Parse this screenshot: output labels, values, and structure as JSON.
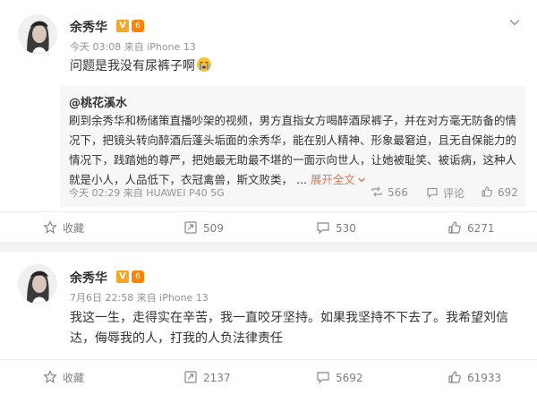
{
  "post1": {
    "author": "余秀华",
    "level_badge": "6",
    "verified_badge": "V",
    "meta": "今天 03:08 来自 iPhone 13",
    "text": "问题是我没有尿裤子啊",
    "retweet": {
      "author": "@桃花溪水",
      "text": "刷到余秀华和杨储策直播吵架的视频，男方直指女方喝醉酒尿裤子，并在对方毫无防备的情况下，把镜头转向醉酒后蓬头垢面的余秀华，能在别人精神、形象最窘迫，且无自保能力的情况下，践踏她的尊严，把她最无助最不堪的一面示向世人，让她被耻笑、被诟病，这种人就是小人，人品低下，衣冠禽兽，斯文败类，",
      "ellipsis": "...",
      "more": "展开全文",
      "meta": "今天 02:29 来自 HUAWEI P40 5G",
      "reposts": "566",
      "comments": "评论",
      "likes": "692"
    },
    "actions": {
      "favorite": "收藏",
      "reposts": "509",
      "comments": "530",
      "likes": "6271"
    }
  },
  "post2": {
    "author": "余秀华",
    "level_badge": "6",
    "verified_badge": "V",
    "meta": "7月6日 22:58 来自 iPhone 13",
    "text": "我这一生，走得实在辛苦，我一直咬牙坚持。如果我坚持不下去了。我希望刘信达，侮辱我的人，打我的人负法律责任",
    "actions": {
      "favorite": "收藏",
      "reposts": "2137",
      "comments": "5692",
      "likes": "61933"
    }
  }
}
